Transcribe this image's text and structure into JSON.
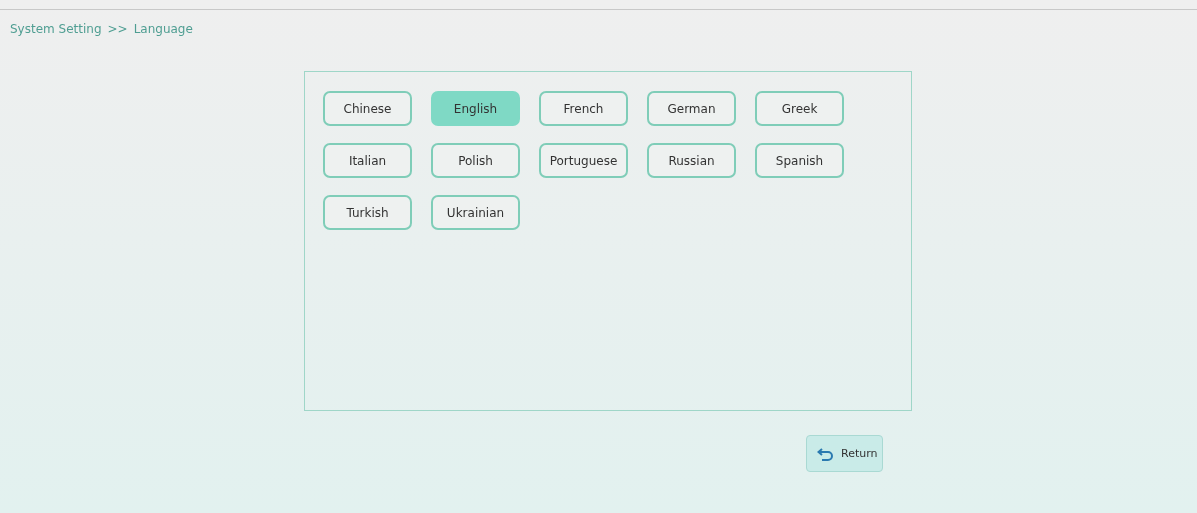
{
  "breadcrumb": {
    "section": "System Setting",
    "separator": ">>",
    "page": "Language"
  },
  "languages": [
    {
      "label": "Chinese",
      "selected": false
    },
    {
      "label": "English",
      "selected": true
    },
    {
      "label": "French",
      "selected": false
    },
    {
      "label": "German",
      "selected": false
    },
    {
      "label": "Greek",
      "selected": false
    },
    {
      "label": "Italian",
      "selected": false
    },
    {
      "label": "Polish",
      "selected": false
    },
    {
      "label": "Portuguese",
      "selected": false
    },
    {
      "label": "Russian",
      "selected": false
    },
    {
      "label": "Spanish",
      "selected": false
    },
    {
      "label": "Turkish",
      "selected": false
    },
    {
      "label": "Ukrainian",
      "selected": false
    }
  ],
  "return_button": {
    "label": "Return"
  }
}
